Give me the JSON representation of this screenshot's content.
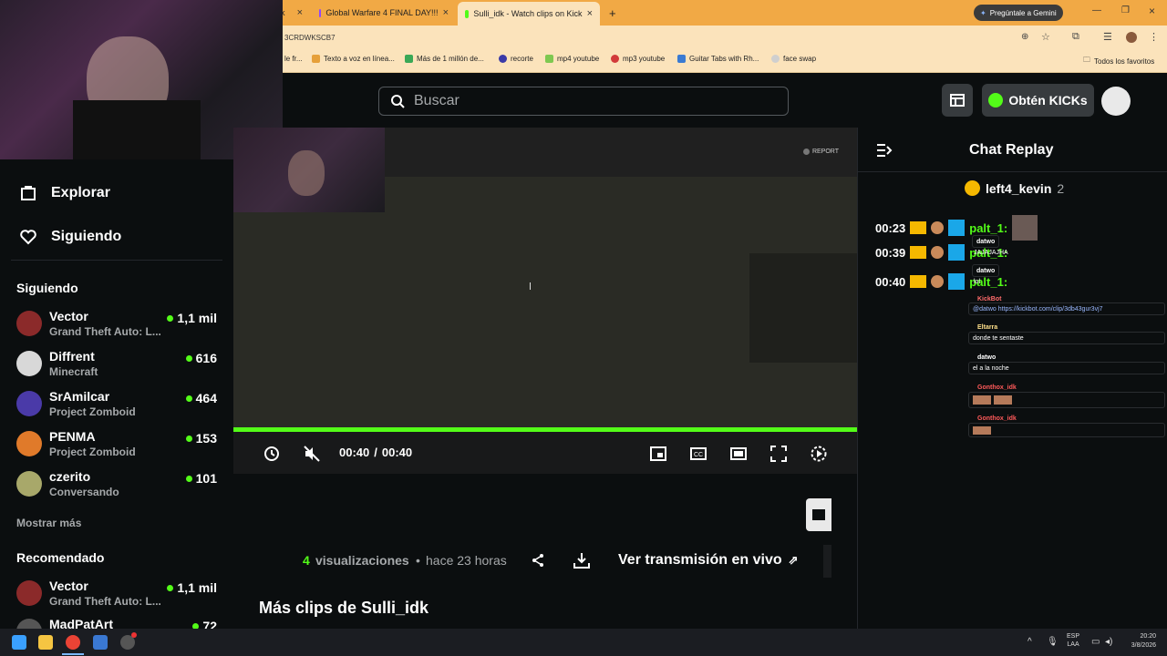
{
  "browser": {
    "tabs": [
      {
        "label": "k",
        "favicon": "kick"
      },
      {
        "label": "Global Warfare 4 FINAL DAY!!!",
        "favicon": "twitch"
      },
      {
        "label": "Sulli_idk - Watch clips on Kick",
        "favicon": "kick"
      }
    ],
    "new_tab": "+",
    "gemini_button": "Pregúntale a Gemini",
    "address": "3CRDWKSCB7",
    "bookmarks": [
      "le fr...",
      "Texto a voz en línea...",
      "Más de 1 millón de...",
      "recorte",
      "mp4 youtube",
      "mp3 youtube",
      "Guitar Tabs with Rh...",
      "face swap"
    ],
    "all_favorites": "Todos los favoritos"
  },
  "header": {
    "search_placeholder": "Buscar",
    "kicks_button": "Obtén KICKs",
    "accent": "#53fc18"
  },
  "sidebar": {
    "nav": [
      {
        "label": "Explorar",
        "icon": "explore-icon"
      },
      {
        "label": "Siguiendo",
        "icon": "heart-icon"
      }
    ],
    "following_title": "Siguiendo",
    "following": [
      {
        "name": "Vector",
        "game": "Grand Theft Auto: L...",
        "viewers": "1,1 mil"
      },
      {
        "name": "Diffrent",
        "game": "Minecraft",
        "viewers": "616"
      },
      {
        "name": "SrAmilcar",
        "game": "Project Zomboid",
        "viewers": "464"
      },
      {
        "name": "PENMA",
        "game": "Project Zomboid",
        "viewers": "153"
      },
      {
        "name": "czerito",
        "game": "Conversando",
        "viewers": "101"
      }
    ],
    "show_more": "Mostrar más",
    "recommended_title": "Recomendado",
    "recommended": [
      {
        "name": "Vector",
        "game": "Grand Theft Auto: L...",
        "viewers": "1,1 mil"
      },
      {
        "name": "MadPatArt",
        "game": "",
        "viewers": "72"
      }
    ]
  },
  "video": {
    "report": "REPORT",
    "time_current": "00:40",
    "time_sep": "/",
    "time_total": "00:40",
    "progress": 1.0
  },
  "clip_info": {
    "views_count": "4",
    "views_label": "visualizaciones",
    "separator": "•",
    "time_ago": "hace 23 horas",
    "watch_live": "Ver transmisión en vivo",
    "more_clips": "Más clips de Sulli_idk"
  },
  "chat": {
    "title": "Chat Replay",
    "pinned_user": "left4_kevin",
    "pinned_count": "2",
    "messages": [
      {
        "time": "00:23",
        "user": "palt_1:"
      },
      {
        "time": "00:39",
        "user": "palt_1:"
      },
      {
        "time": "00:40",
        "user": "palt_1:"
      }
    ],
    "overlay": [
      {
        "user": "datwo",
        "text": "JAJAJAJHA"
      },
      {
        "user": "datwo",
        "text": "lol"
      },
      {
        "user": "KickBot",
        "text": "@datwo https://kickbot.com/clip/3db43gur3vj7"
      },
      {
        "user": "Eltarra",
        "text": "donde te sentaste"
      },
      {
        "user": "datwo",
        "text": "el    a la noche"
      },
      {
        "user": "Gonthox_idk",
        "text": ""
      },
      {
        "user": "Gonthox_idk",
        "text": ""
      }
    ]
  },
  "taskbar": {
    "lang": "ESP",
    "lang2": "LAA",
    "time": "20:20",
    "date": "3/8/2026"
  }
}
